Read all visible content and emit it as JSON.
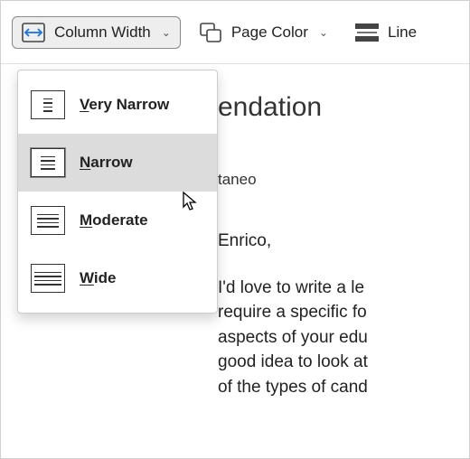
{
  "toolbar": {
    "columnWidth": {
      "label": "Column Width"
    },
    "pageColor": {
      "label": "Page Color"
    },
    "lineFocus": {
      "label": "Line "
    }
  },
  "dropdown": {
    "items": [
      {
        "label": "Very Narrow"
      },
      {
        "label": "Narrow"
      },
      {
        "label": "Moderate"
      },
      {
        "label": "Wide"
      }
    ]
  },
  "document": {
    "titleFragment": "endation",
    "authorFragment": "taneo",
    "greeting": "Enrico,",
    "bodyLines": [
      "I'd love to write a le",
      "require a specific fo",
      "aspects of your edu",
      "good idea to look at",
      "of the types of cand"
    ]
  }
}
